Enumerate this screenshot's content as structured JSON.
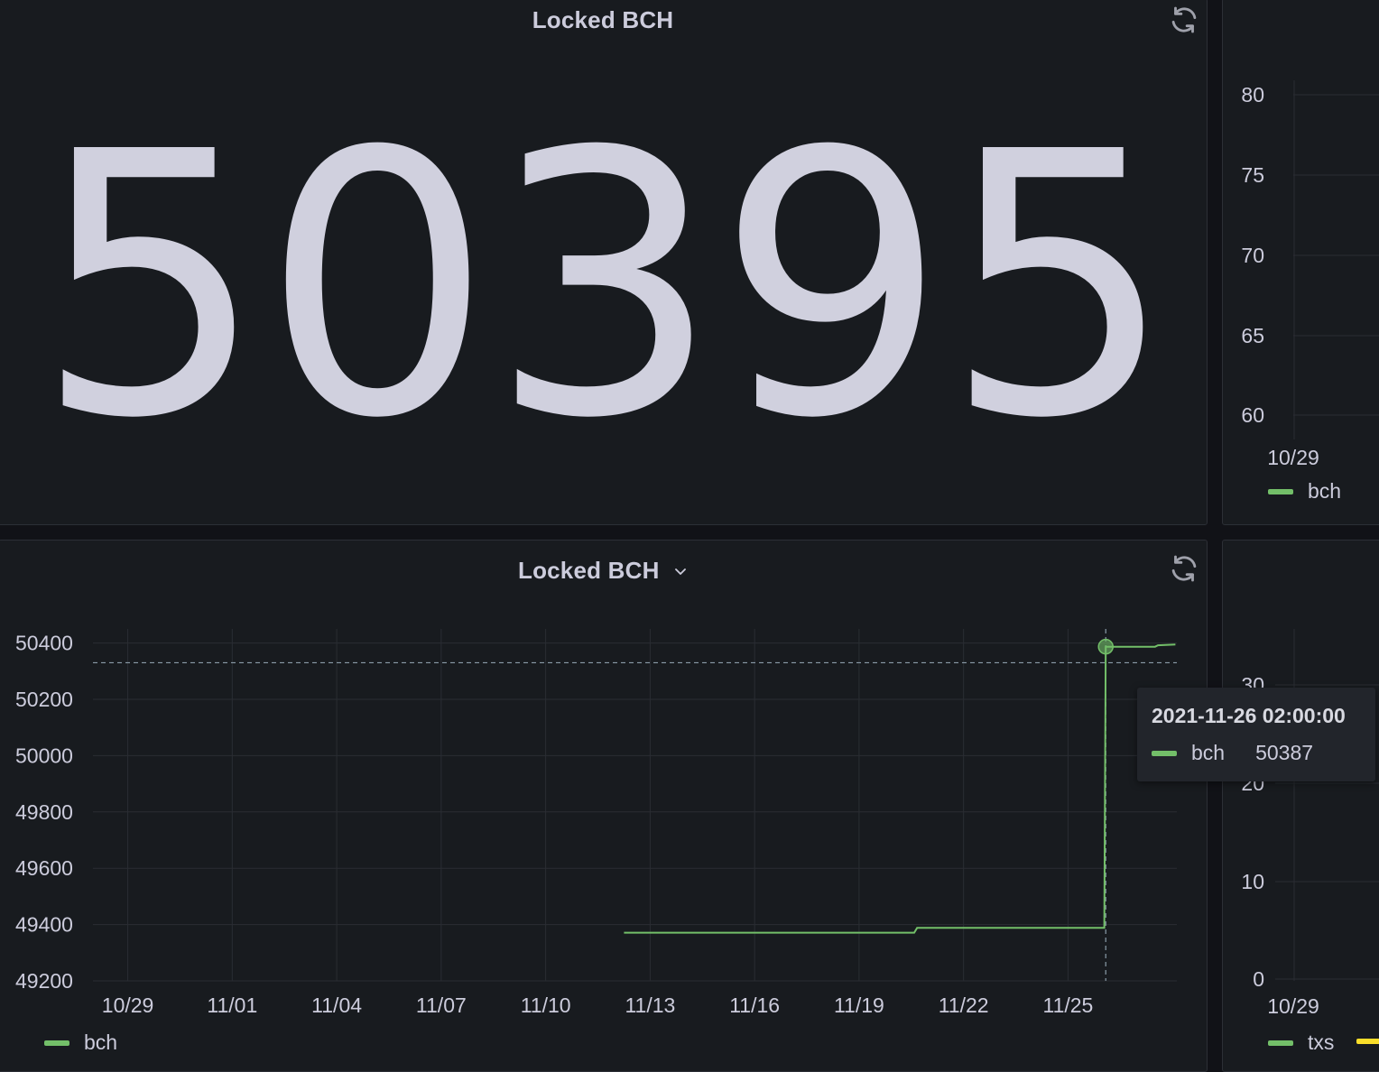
{
  "stat_panel": {
    "title": "Locked BCH",
    "value": "50395"
  },
  "graph_panel": {
    "title": "Locked BCH",
    "legend": [
      {
        "label": "bch",
        "color": "#73bf69"
      }
    ]
  },
  "right_top_panel": {
    "y_ticks": [
      "80",
      "75",
      "70",
      "65",
      "60"
    ],
    "x_ticks": [
      "10/29"
    ],
    "legend": [
      {
        "label": "bch",
        "color": "#73bf69"
      }
    ]
  },
  "right_bottom_panel": {
    "y_ticks": [
      "30",
      "20",
      "10",
      "0"
    ],
    "x_ticks": [
      "10/29"
    ],
    "legend": [
      {
        "label": "txs",
        "color": "#73bf69"
      },
      {
        "label": "",
        "color": "#fade2a"
      }
    ]
  },
  "tooltip": {
    "time": "2021-11-26 02:00:00",
    "series": "bch",
    "value": "50387"
  },
  "chart_data": {
    "type": "line",
    "title": "Locked BCH",
    "x_tick_labels": [
      "10/29",
      "11/01",
      "11/04",
      "11/07",
      "11/10",
      "11/13",
      "11/16",
      "11/19",
      "11/22",
      "11/25"
    ],
    "y_tick_labels": [
      "50400",
      "50200",
      "50000",
      "49800",
      "49600",
      "49400",
      "49200"
    ],
    "ylim": [
      49200,
      50450
    ],
    "xlim": [
      "2021-10-28T00:00",
      "2021-11-28T03:00"
    ],
    "grid": true,
    "legend_position": "bottom-left",
    "series": [
      {
        "name": "bch",
        "color": "#73bf69",
        "points": [
          [
            "2021-11-12T06:00",
            49371
          ],
          [
            "2021-11-19T02:00",
            49371
          ],
          [
            "2021-11-19T04:00",
            49371
          ],
          [
            "2021-11-20T14:00",
            49371
          ],
          [
            "2021-11-20T16:00",
            49388
          ],
          [
            "2021-11-26T01:00",
            49388
          ],
          [
            "2021-11-26T02:00",
            50387
          ],
          [
            "2021-11-27T12:00",
            50387
          ],
          [
            "2021-11-27T14:00",
            50392
          ],
          [
            "2021-11-28T02:00",
            50395
          ]
        ]
      }
    ],
    "hover": {
      "x": "2021-11-26T02:00",
      "y": 50387,
      "crosshair_y": 50330
    }
  }
}
